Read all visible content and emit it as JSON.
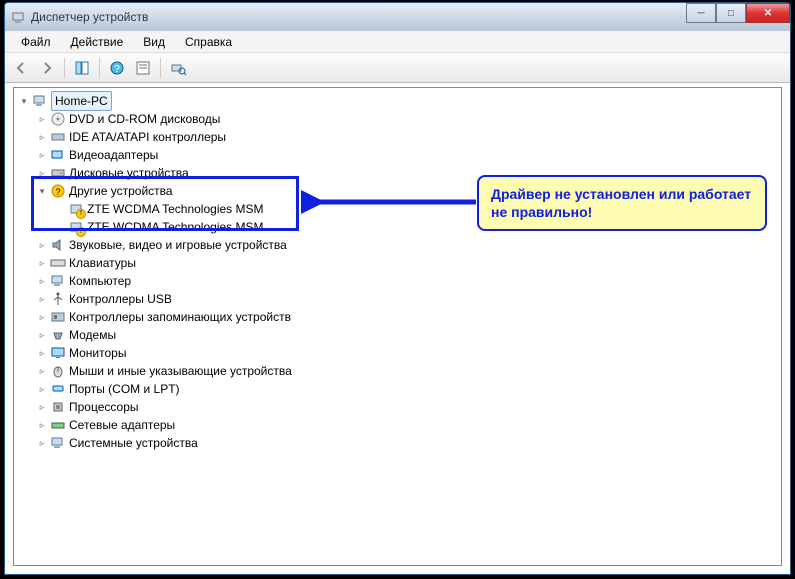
{
  "window": {
    "title": "Диспетчер устройств"
  },
  "menu": {
    "file": "Файл",
    "action": "Действие",
    "view": "Вид",
    "help": "Справка"
  },
  "tree": {
    "root": "Home-PC",
    "dvd": "DVD и CD-ROM дисководы",
    "ide": "IDE ATA/ATAPI контроллеры",
    "video": "Видеоадаптеры",
    "disk": "Дисковые устройства",
    "other": "Другие устройства",
    "other_zte1": "ZTE WCDMA Technologies MSM",
    "other_zte2": "ZTE WCDMA Technologies MSM",
    "sound": "Звуковые, видео и игровые устройства",
    "keyboard": "Клавиатуры",
    "computer": "Компьютер",
    "usb": "Контроллеры USB",
    "storage_ctrl": "Контроллеры запоминающих устройств",
    "modems": "Модемы",
    "monitors": "Мониторы",
    "mice": "Мыши и иные указывающие устройства",
    "ports": "Порты (COM и LPT)",
    "cpu": "Процессоры",
    "net": "Сетевые адаптеры",
    "system": "Системные устройства"
  },
  "callout": {
    "text": "Драйвер не установлен или работает не правильно!"
  },
  "colors": {
    "highlight_border": "#1020e0",
    "callout_bg": "#fdfcb0"
  }
}
